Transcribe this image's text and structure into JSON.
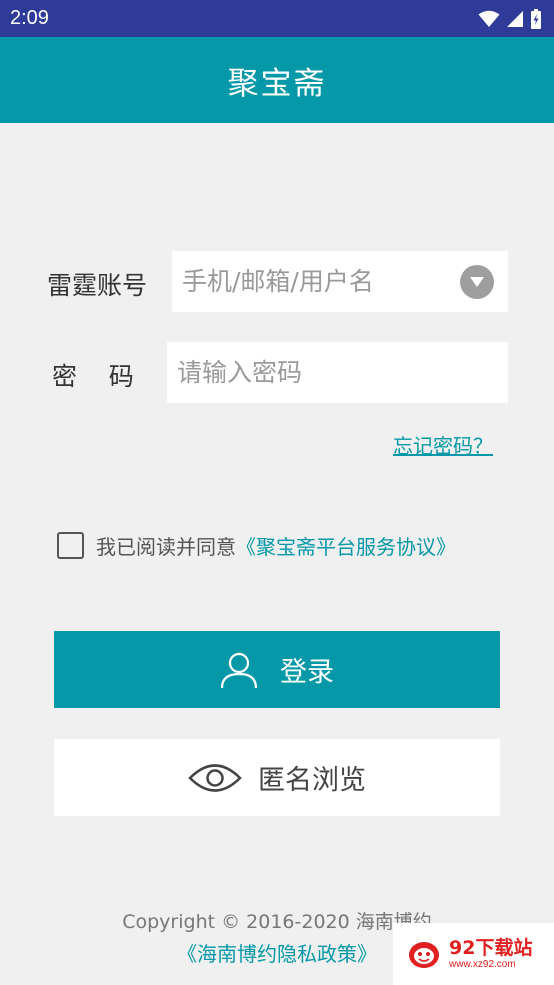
{
  "status_bar": {
    "time": "2:09",
    "icons": [
      "wifi-icon",
      "signal-icon",
      "battery-icon"
    ]
  },
  "app_bar": {
    "title": "聚宝斋"
  },
  "login_form": {
    "account_label": "雷霆账号",
    "account_placeholder": "手机/邮箱/用户名",
    "password_label": "密    码",
    "password_placeholder": "请输入密码",
    "forgot_password": "忘记密码？"
  },
  "agreement": {
    "text": "我已阅读并同意",
    "link": "《聚宝斋平台服务协议》",
    "checked": false
  },
  "buttons": {
    "login_label": "登录",
    "anonymous_label": "匿名浏览"
  },
  "footer": {
    "copyright": "Copyright © 2016-2020 海南博约",
    "privacy_link": "《海南博约隐私政策》"
  },
  "watermark": {
    "brand": "92下载站",
    "url": "www.xz92.com"
  },
  "colors": {
    "status_bar": "#2f3b99",
    "accent": "#0598a8",
    "background": "#f0f0f0"
  }
}
